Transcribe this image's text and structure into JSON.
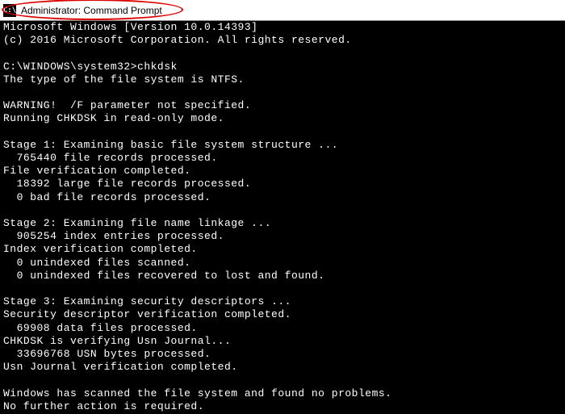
{
  "titlebar": {
    "title": "Administrator: Command Prompt"
  },
  "console": {
    "version_line": "Microsoft Windows [Version 10.0.14393]",
    "copyright": "(c) 2016 Microsoft Corporation. All rights reserved.",
    "blank": "",
    "prompt_path": "C:\\WINDOWS\\system32>",
    "command": "chkdsk",
    "fs_type": "The type of the file system is NTFS.",
    "warning1": "WARNING!  /F parameter not specified.",
    "warning2": "Running CHKDSK in read-only mode.",
    "stage1_header": "Stage 1: Examining basic file system structure ...",
    "stage1_records": "  765440 file records processed.",
    "stage1_verif": "File verification completed.",
    "stage1_large": "  18392 large file records processed.",
    "stage1_bad": "  0 bad file records processed.",
    "stage2_header": "Stage 2: Examining file name linkage ...",
    "stage2_index": "  905254 index entries processed.",
    "stage2_verif": "Index verification completed.",
    "stage2_unindexed": "  0 unindexed files scanned.",
    "stage2_recovered": "  0 unindexed files recovered to lost and found.",
    "stage3_header": "Stage 3: Examining security descriptors ...",
    "stage3_verif": "Security descriptor verification completed.",
    "stage3_data": "  69908 data files processed.",
    "stage3_usn": "CHKDSK is verifying Usn Journal...",
    "stage3_usn_bytes": "  33696768 USN bytes processed.",
    "stage3_usn_verif": "Usn Journal verification completed.",
    "result1": "Windows has scanned the file system and found no problems.",
    "result2": "No further action is required."
  }
}
